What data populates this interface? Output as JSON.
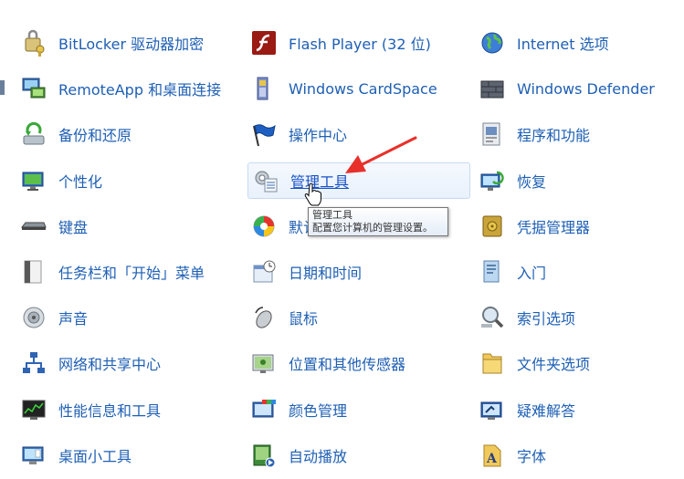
{
  "columns": [
    [
      {
        "label": "BitLocker 驱动器加密",
        "icon": "bitlocker-key-icon"
      },
      {
        "label": "RemoteApp 和桌面连接",
        "icon": "remoteapp-icon"
      },
      {
        "label": "备份和还原",
        "icon": "backup-restore-icon"
      },
      {
        "label": "个性化",
        "icon": "personalization-icon"
      },
      {
        "label": "键盘",
        "icon": "keyboard-icon"
      },
      {
        "label": "任务栏和「开始」菜单",
        "icon": "taskbar-icon"
      },
      {
        "label": "声音",
        "icon": "speaker-icon"
      },
      {
        "label": "网络和共享中心",
        "icon": "network-icon"
      },
      {
        "label": "性能信息和工具",
        "icon": "performance-icon"
      },
      {
        "label": "桌面小工具",
        "icon": "gadgets-icon"
      }
    ],
    [
      {
        "label": "Flash Player (32 位)",
        "icon": "flash-icon"
      },
      {
        "label": "Windows CardSpace",
        "icon": "cardspace-icon"
      },
      {
        "label": "操作中心",
        "icon": "action-center-flag-icon"
      },
      {
        "label": "管理工具",
        "icon": "admin-tools-icon",
        "hover": true
      },
      {
        "label": "默认程序",
        "icon": "default-programs-icon"
      },
      {
        "label": "日期和时间",
        "icon": "date-time-icon"
      },
      {
        "label": "鼠标",
        "icon": "mouse-icon"
      },
      {
        "label": "位置和其他传感器",
        "icon": "location-sensor-icon"
      },
      {
        "label": "颜色管理",
        "icon": "color-management-icon"
      },
      {
        "label": "自动播放",
        "icon": "autoplay-icon"
      }
    ],
    [
      {
        "label": "Internet 选项",
        "icon": "internet-globe-icon"
      },
      {
        "label": "Windows Defender",
        "icon": "defender-wall-icon"
      },
      {
        "label": "程序和功能",
        "icon": "programs-icon"
      },
      {
        "label": "恢复",
        "icon": "recovery-icon"
      },
      {
        "label": "凭据管理器",
        "icon": "credential-vault-icon"
      },
      {
        "label": "入门",
        "icon": "getting-started-icon"
      },
      {
        "label": "索引选项",
        "icon": "indexing-magnifier-icon"
      },
      {
        "label": "文件夹选项",
        "icon": "folder-options-icon"
      },
      {
        "label": "疑难解答",
        "icon": "troubleshoot-icon"
      },
      {
        "label": "字体",
        "icon": "fonts-icon"
      }
    ]
  ],
  "tooltip": {
    "title": "管理工具",
    "description": "配置您计算机的管理设置。"
  },
  "colors": {
    "link": "#1e5fb4",
    "hover_bg": "#e9f1fc",
    "annotation_arrow": "#e8302a"
  }
}
